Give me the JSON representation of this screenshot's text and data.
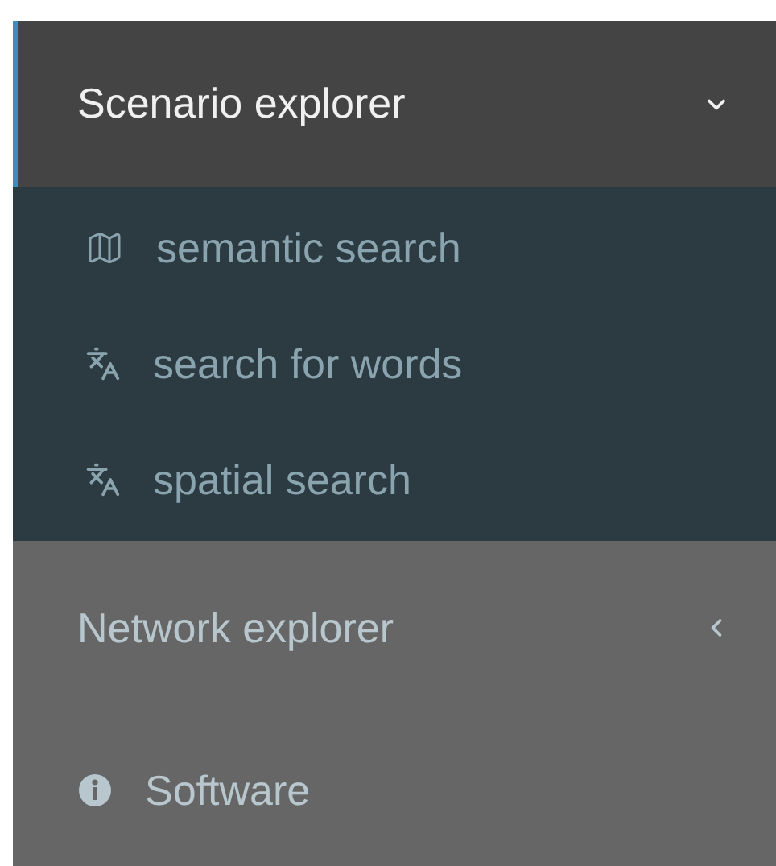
{
  "sidebar": {
    "items": [
      {
        "kind": "section",
        "label": "Scenario explorer",
        "selected": true,
        "expanded": true,
        "children": [
          {
            "kind": "map",
            "label": "semantic search"
          },
          {
            "kind": "translate",
            "label": "search for words"
          },
          {
            "kind": "translate",
            "label": "spatial search"
          }
        ]
      },
      {
        "kind": "section",
        "label": "Network explorer",
        "selected": false,
        "expanded": false
      },
      {
        "kind": "info",
        "label": "Software",
        "selected": false
      }
    ]
  }
}
